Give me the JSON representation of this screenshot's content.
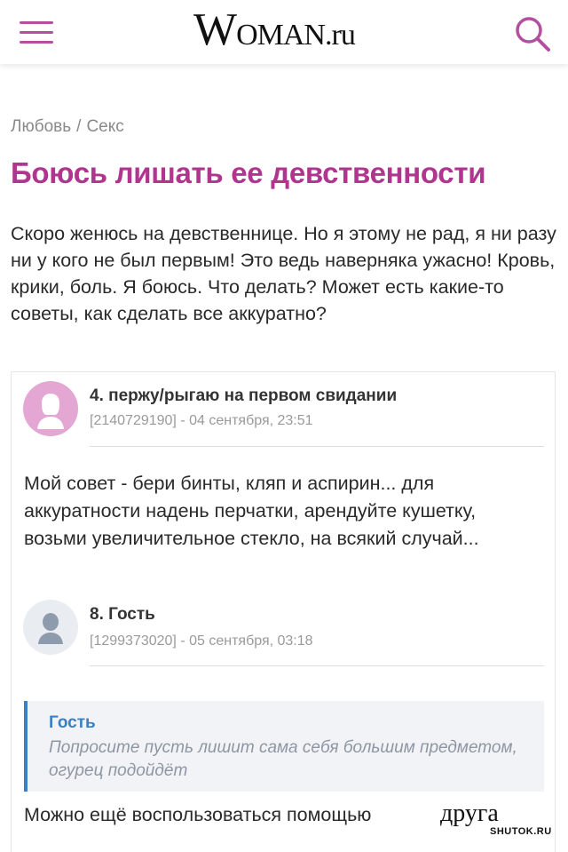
{
  "header": {
    "menu_icon": "hamburger-menu-icon",
    "logo_first": "W",
    "logo_middle": "OMAN",
    "logo_domain": ".ru",
    "search_icon": "search-icon",
    "accent_color": "#b44fa0"
  },
  "breadcrumb": {
    "items": [
      "Любовь",
      "Секс"
    ],
    "separator": "/"
  },
  "article": {
    "title": "Боюсь лишать ее девственности",
    "title_color": "#b0358f",
    "question": "Скоро женюсь на девственнице. Но я этому не рад, я ни разу ни у кого не был первым! Это ведь наверняка ужасно! Кровь, крики, боль. Я боюсь. Что делать? Может есть какие-то советы, как сделать все аккуратно?"
  },
  "comments": [
    {
      "author": "4. пержу/рыгаю на первом свидании",
      "meta": "[2140729190] - 04 сентября, 23:51",
      "avatar": "female-avatar-icon",
      "text": "Мой совет - бери бинты, кляп и аспирин... для аккуратности надень перчатки, арендуйте кушетку, возьми увеличительное стекло, на всякий случай..."
    },
    {
      "author": "8. Гость",
      "meta": "[1299373020] - 05 сентября, 03:18",
      "avatar": "male-avatar-icon",
      "quote": {
        "author": "Гость",
        "text": "Попросите пусть лишит сама себя большим предметом, огурец подойдёт"
      },
      "text": "Можно ещё воспользоваться помощью"
    }
  ],
  "watermark": {
    "word": "друга",
    "site": "SHUTOK.RU"
  }
}
